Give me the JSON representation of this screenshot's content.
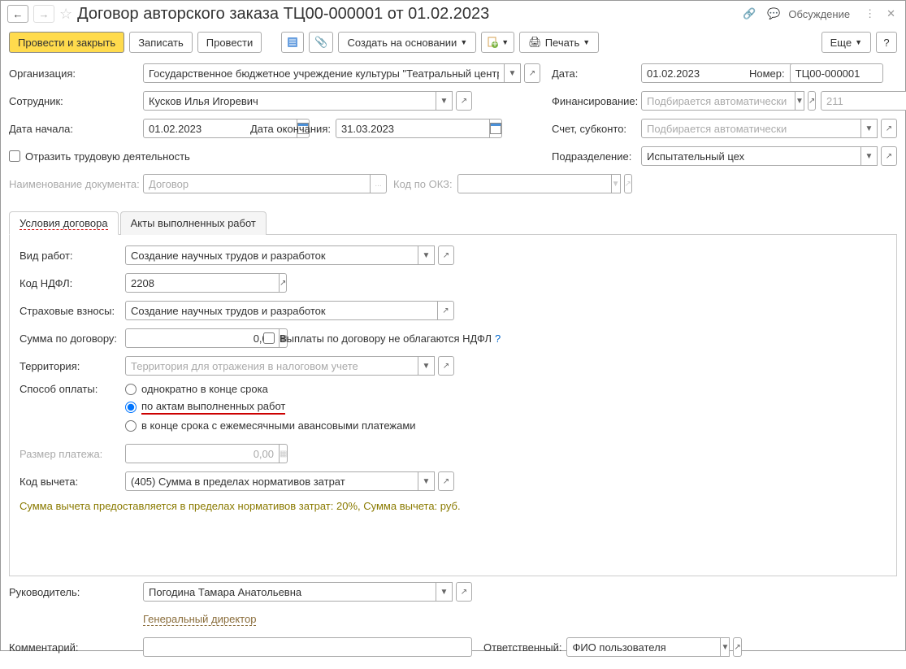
{
  "header": {
    "title": "Договор авторского заказа ТЦ00-000001 от 01.02.2023",
    "discuss": "Обсуждение"
  },
  "toolbar": {
    "post_close": "Провести и закрыть",
    "save": "Записать",
    "post": "Провести",
    "create_based": "Создать на основании",
    "print": "Печать",
    "more": "Еще"
  },
  "left": {
    "org_label": "Организация:",
    "org_value": "Государственное бюджетное учреждение культуры \"Театральный центр\"",
    "emp_label": "Сотрудник:",
    "emp_value": "Кусков Илья Игоревич",
    "start_label": "Дата начала:",
    "start_value": "01.02.2023",
    "end_label": "Дата окончания:",
    "end_value": "31.03.2023",
    "labor_check": "Отразить трудовую деятельность",
    "docname_label": "Наименование документа:",
    "docname_value": "Договор",
    "okz_label": "Код по ОКЗ:"
  },
  "right": {
    "date_label": "Дата:",
    "date_value": "01.02.2023",
    "num_label": "Номер:",
    "num_value": "ТЦ00-000001",
    "fin_label": "Финансирование:",
    "fin_ph": "Подбирается автоматически",
    "fin_code": "211",
    "acct_label": "Счет, субконто:",
    "acct_ph": "Подбирается автоматически",
    "dept_label": "Подразделение:",
    "dept_value": "Испытательный цех"
  },
  "tabs": {
    "t1": "Условия договора",
    "t2": "Акты выполненных работ"
  },
  "contract": {
    "work_label": "Вид работ:",
    "work_value": "Создание научных трудов и разработок",
    "ndfl_label": "Код НДФЛ:",
    "ndfl_value": "2208",
    "ins_label": "Страховые взносы:",
    "ins_value": "Создание научных трудов и разработок",
    "sum_label": "Сумма по договору:",
    "sum_value": "0,00",
    "sum_check": "Выплаты по договору не облагаются НДФЛ",
    "terr_label": "Территория:",
    "terr_ph": "Территория для отражения в налоговом учете",
    "pay_label": "Способ оплаты:",
    "pay_r1": "однократно в конце срока",
    "pay_r2": "по актам выполненных работ",
    "pay_r3": "в конце срока с ежемесячными авансовыми платежами",
    "amt_label": "Размер платежа:",
    "amt_value": "0,00",
    "ded_label": "Код вычета:",
    "ded_value": "(405) Сумма в пределах нормативов затрат",
    "note": "Сумма вычета предоставляется в пределах нормативов затрат: 20%,  Сумма вычета:  руб."
  },
  "footer": {
    "mgr_label": "Руководитель:",
    "mgr_value": "Погодина Тамара Анатольевна",
    "mgr_pos": "Генеральный директор",
    "cmt_label": "Комментарий:",
    "resp_label": "Ответственный:",
    "resp_value": "ФИО пользователя"
  }
}
